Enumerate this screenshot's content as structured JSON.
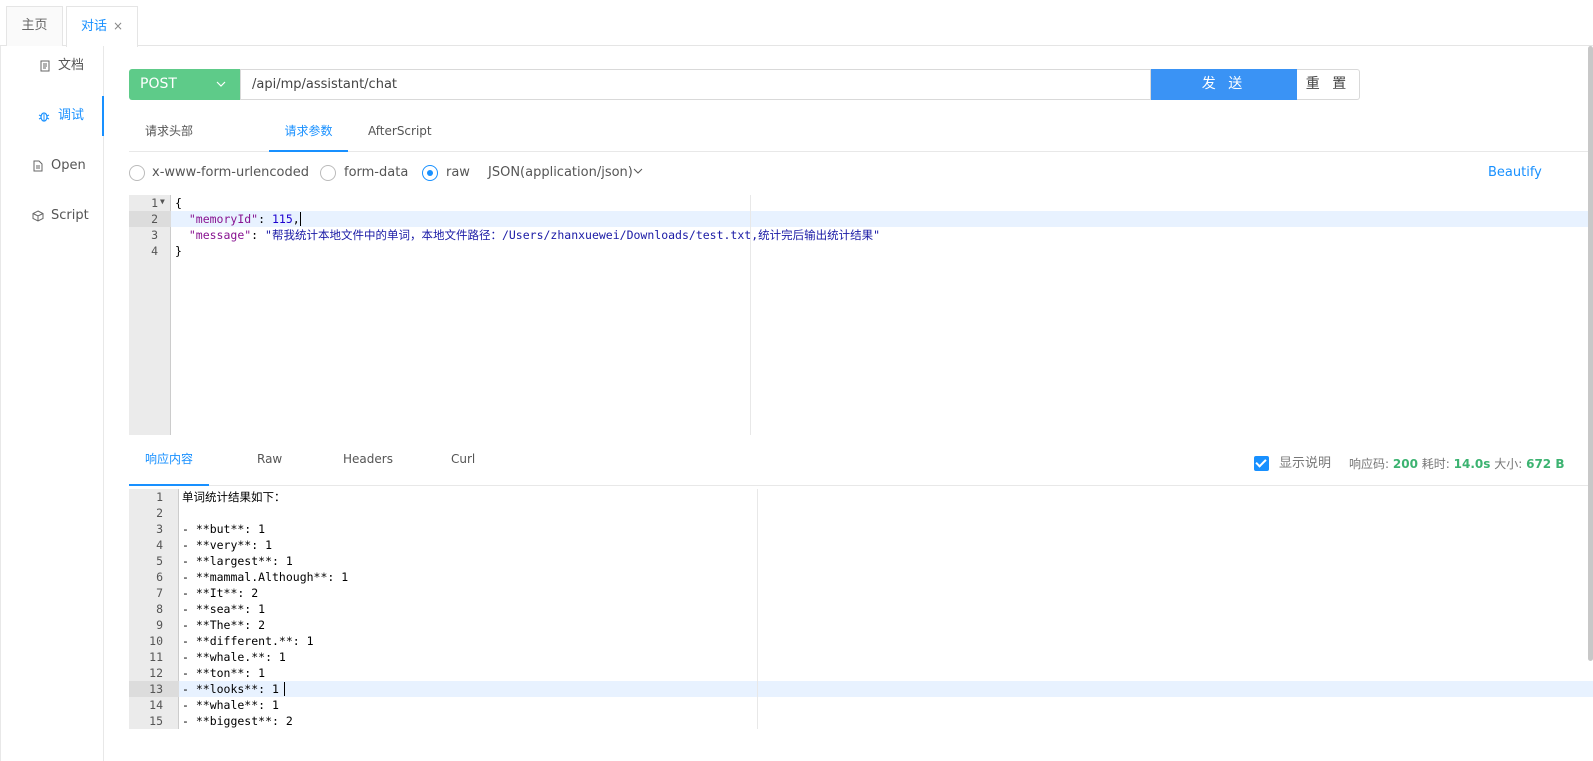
{
  "tabs": [
    {
      "label": "主页"
    },
    {
      "label": "对话",
      "close": "×"
    }
  ],
  "sidebar": {
    "items": [
      {
        "label": "文档"
      },
      {
        "label": "调试"
      },
      {
        "label": "Open"
      },
      {
        "label": "Script"
      }
    ]
  },
  "request": {
    "method": "POST",
    "url": "/api/mp/assistant/chat",
    "send_label": "发 送",
    "reset_label": "重 置"
  },
  "req_tabs": [
    {
      "label": "请求头部"
    },
    {
      "label": "请求参数"
    },
    {
      "label": "AfterScript"
    }
  ],
  "body_types": {
    "options": [
      {
        "label": "x-www-form-urlencoded"
      },
      {
        "label": "form-data"
      },
      {
        "label": "raw"
      }
    ],
    "selected": "raw",
    "content_type": "JSON(application/json)",
    "beautify_label": "Beautify"
  },
  "request_body": {
    "line_numbers": [
      "1",
      "2",
      "3",
      "4"
    ],
    "lines": [
      "{",
      "  \"memoryId\": 115,",
      "  \"message\": \"帮我统计本地文件中的单词，本地文件路径：/Users/zhanxuewei/Downloads/test.txt,统计完后输出统计结果\"",
      "}"
    ],
    "memoryId_key": "\"memoryId\"",
    "memoryId_value": "115",
    "message_key": "\"message\"",
    "message_value": "\"帮我统计本地文件中的单词，本地文件路径：/Users/zhanxuewei/Downloads/test.txt,统计完后输出统计结果\"",
    "punct_colon": ": ",
    "punct_comma": ","
  },
  "resp_tabs": [
    {
      "label": "响应内容"
    },
    {
      "label": "Raw"
    },
    {
      "label": "Headers"
    },
    {
      "label": "Curl"
    }
  ],
  "response_meta": {
    "show_desc_label": "显示说明",
    "show_desc_checked": true,
    "status_label": "响应码:",
    "status_value": "200",
    "time_label": "耗时:",
    "time_value": "14.0s",
    "size_label": "大小:",
    "size_value": "672 B"
  },
  "response_body": {
    "line_numbers": [
      "1",
      "2",
      "3",
      "4",
      "5",
      "6",
      "7",
      "8",
      "9",
      "10",
      "11",
      "12",
      "13",
      "14",
      "15"
    ],
    "lines": [
      "单词统计结果如下：",
      "",
      "- **but**: 1",
      "- **very**: 1",
      "- **largest**: 1",
      "- **mammal.Although**: 1",
      "- **It**: 2",
      "- **sea**: 1",
      "- **The**: 2",
      "- **different.**: 1",
      "- **whale.**: 1",
      "- **ton**: 1",
      "- **looks**: 1",
      "- **whale**: 1",
      "- **biggest**: 2"
    ]
  },
  "colors": {
    "accent": "#1890ff",
    "method": "#5ecb89",
    "send": "#3a93f5",
    "success": "#3cb371"
  }
}
